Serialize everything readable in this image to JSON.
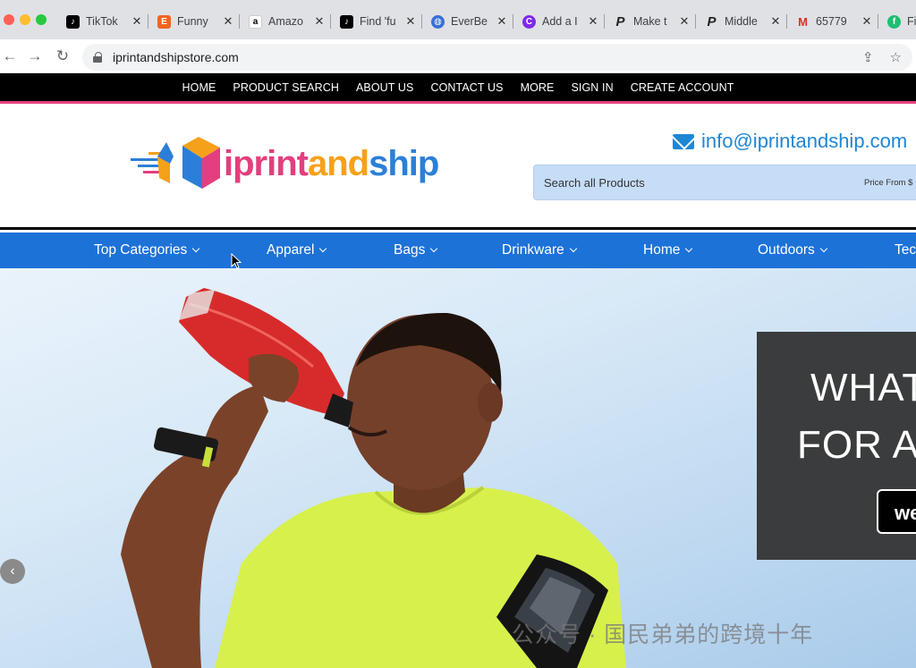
{
  "browser": {
    "tabs": [
      {
        "title": "TikTok",
        "icon": "tiktok-icon",
        "color": "#000000"
      },
      {
        "title": "Funny",
        "icon": "etsy-icon",
        "color": "#f1641e"
      },
      {
        "title": "Amazo",
        "icon": "amazon-icon",
        "color": "#ffffff"
      },
      {
        "title": "Find 'fu",
        "icon": "tiktok-icon",
        "color": "#000000"
      },
      {
        "title": "EverBe",
        "icon": "globe-icon",
        "color": "#3a6fd8"
      },
      {
        "title": "Add a I",
        "icon": "canva-icon",
        "color": "#7d2ae8"
      },
      {
        "title": "Make t",
        "icon": "p-icon",
        "color": "#ffffff"
      },
      {
        "title": "Middle",
        "icon": "p-icon",
        "color": "#ffffff"
      },
      {
        "title": "65779",
        "icon": "gmail-icon",
        "color": "#ffffff"
      },
      {
        "title": "Fiv",
        "icon": "fiverr-icon",
        "color": "#1dbf73"
      }
    ],
    "url": "iprintandshipstore.com"
  },
  "topnav": [
    "HOME",
    "PRODUCT SEARCH",
    "ABOUT US",
    "CONTACT US",
    "MORE",
    "SIGN IN",
    "CREATE ACCOUNT"
  ],
  "header": {
    "logo": {
      "part1": "iprint",
      "part2": "and",
      "part3": "ship"
    },
    "email": "info@iprintandship.com",
    "search_placeholder": "Search all Products",
    "price_label": "Price From $"
  },
  "categories": [
    "Top Categories",
    "Apparel",
    "Bags",
    "Drinkware",
    "Home",
    "Outdoors",
    "Tec"
  ],
  "hero": {
    "line1": "WHAT",
    "line2": "FOR A",
    "button": "we",
    "prev": "‹"
  },
  "watermark": "公众号 · 国民弟弟的跨境十年",
  "colors": {
    "accent": "#1d72d8",
    "pink": "#e5417c",
    "email": "#1f86d4"
  }
}
